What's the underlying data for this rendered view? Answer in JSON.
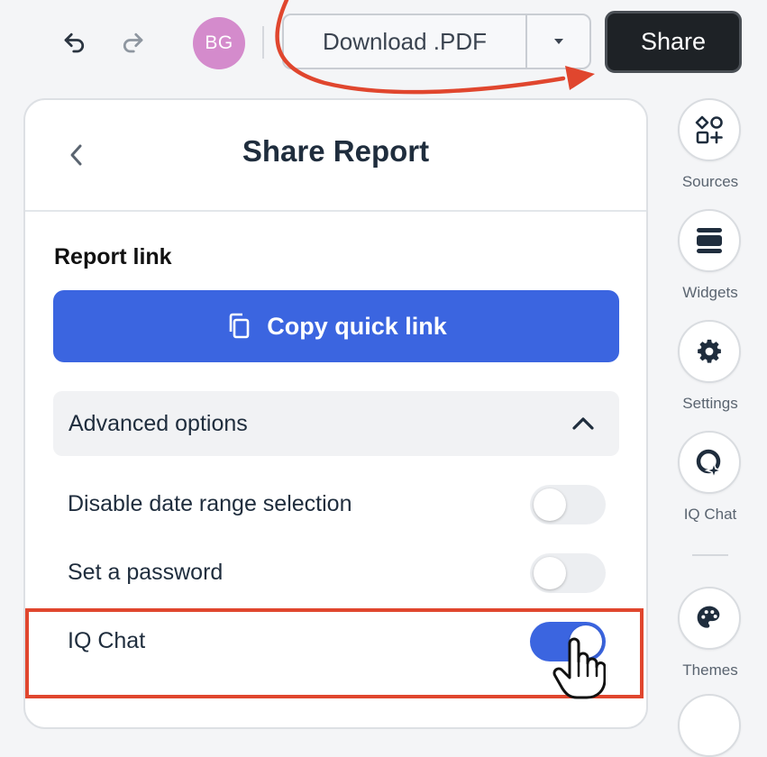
{
  "toolbar": {
    "undo_icon": "undo-icon",
    "redo_icon": "redo-icon",
    "avatar_initials": "BG",
    "avatar_color": "#d48bcc",
    "download_label": "Download .PDF",
    "dropdown_icon": "caret-down-icon",
    "share_label": "Share"
  },
  "panel": {
    "title": "Share Report",
    "back_icon": "chevron-left-icon",
    "section_label": "Report link",
    "copy_button_label": "Copy quick link",
    "copy_icon": "copy-icon",
    "advanced_label": "Advanced options",
    "advanced_icon": "chevron-up-icon",
    "options": [
      {
        "label": "Disable date range selection",
        "enabled": false
      },
      {
        "label": "Set a password",
        "enabled": false
      },
      {
        "label": "IQ Chat",
        "enabled": true
      }
    ]
  },
  "rail": {
    "items": [
      {
        "label": "Sources",
        "icon": "sources-icon"
      },
      {
        "label": "Widgets",
        "icon": "widgets-icon"
      },
      {
        "label": "Settings",
        "icon": "gear-icon"
      },
      {
        "label": "IQ Chat",
        "icon": "iq-chat-icon"
      },
      {
        "label": "Themes",
        "icon": "palette-icon"
      }
    ]
  },
  "colors": {
    "accent": "#3b65e0",
    "share_button": "#1e2226",
    "annotation": "#e0462e"
  }
}
